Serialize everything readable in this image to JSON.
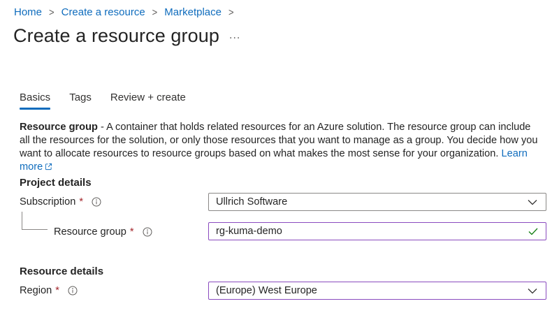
{
  "breadcrumb": {
    "items": [
      "Home",
      "Create a resource",
      "Marketplace"
    ],
    "separator": ">"
  },
  "title": "Create a resource group",
  "more": "...",
  "tabs": [
    {
      "label": "Basics",
      "active": true
    },
    {
      "label": "Tags",
      "active": false
    },
    {
      "label": "Review + create",
      "active": false
    }
  ],
  "description": {
    "bold": "Resource group",
    "text": " - A container that holds related resources for an Azure solution. The resource group can include all the resources for the solution, or only those resources that you want to manage as a group. You decide how you want to allocate resources to resource groups based on what makes the most sense for your organization. ",
    "link": "Learn more"
  },
  "project_details": {
    "heading": "Project details",
    "subscription": {
      "label": "Subscription",
      "required": "*",
      "value": "Ullrich Software"
    },
    "resource_group": {
      "label": "Resource group",
      "required": "*",
      "value": "rg-kuma-demo"
    }
  },
  "resource_details": {
    "heading": "Resource details",
    "region": {
      "label": "Region",
      "required": "*",
      "value": "(Europe) West Europe"
    }
  },
  "colors": {
    "link": "#0f6cbd",
    "required": "#a4262c",
    "focus_border": "#8a4bbf",
    "valid_check": "#107c10"
  }
}
